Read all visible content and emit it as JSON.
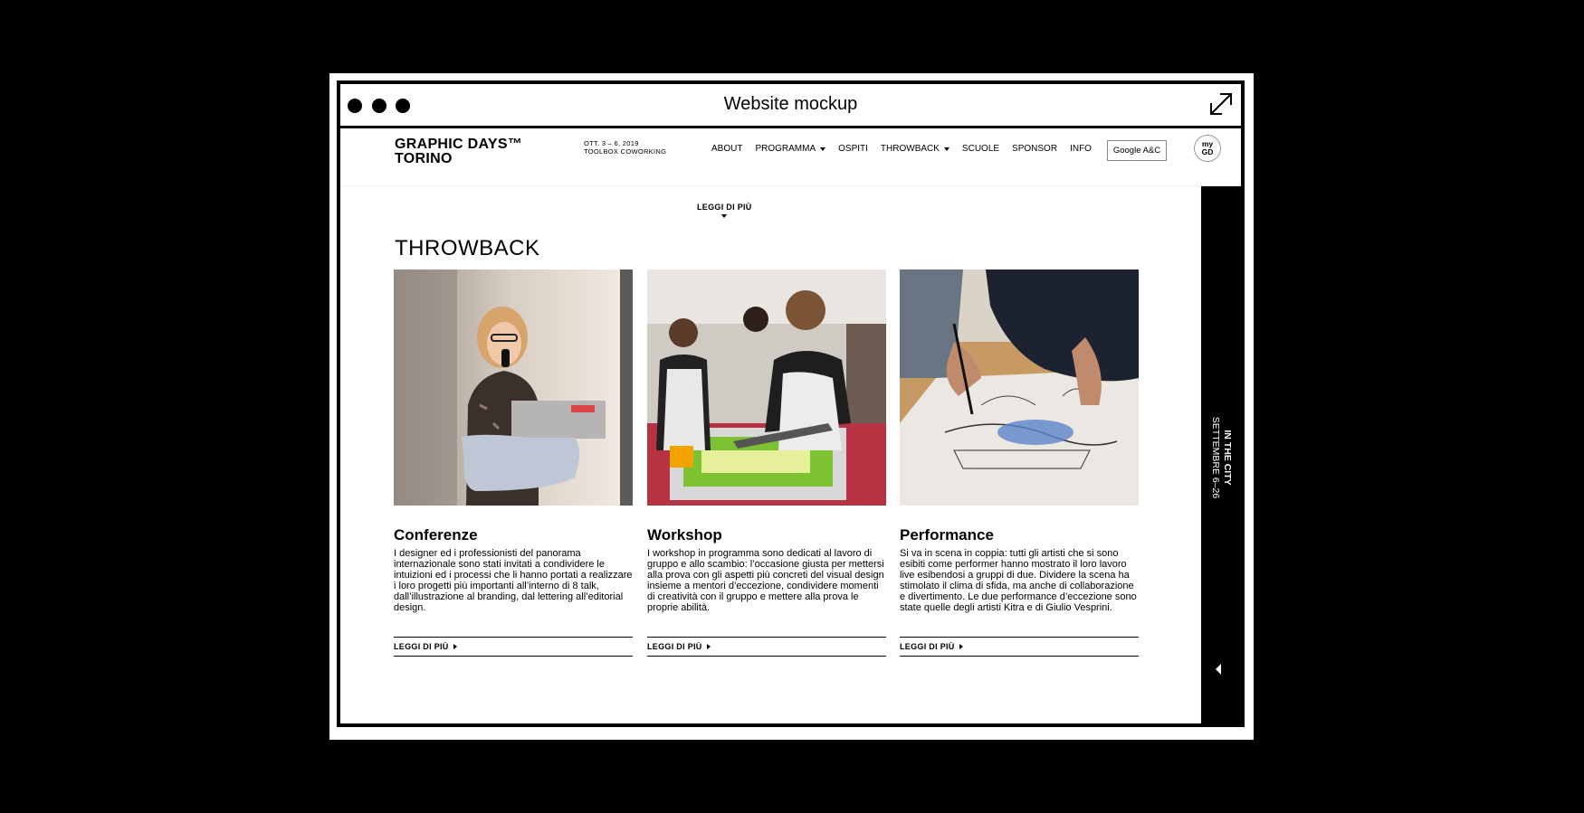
{
  "window": {
    "title": "Website mockup"
  },
  "site": {
    "logo": {
      "line1": "GRAPHIC DAYS™",
      "line2": "TORINO"
    },
    "event": {
      "line1": "OTT. 3 – 6, 2019",
      "line2": "TOOLBOX COWORKING"
    },
    "nav": [
      {
        "label": "ABOUT",
        "dropdown": false
      },
      {
        "label": "PROGRAMMA",
        "dropdown": true
      },
      {
        "label": "OSPITI",
        "dropdown": false
      },
      {
        "label": "THROWBACK",
        "dropdown": true
      },
      {
        "label": "SCUOLE",
        "dropdown": false
      },
      {
        "label": "SPONSOR",
        "dropdown": false
      },
      {
        "label": "INFO",
        "dropdown": false
      }
    ],
    "google_button": "Google A&C",
    "mygd": {
      "line1": "my",
      "line2": "GD"
    },
    "side_strip": {
      "line1": "IN THE CITY",
      "line2": "SETTEMBRE 6–26"
    },
    "readmore_top": "LEGGI DI PIÙ",
    "section_title": "THROWBACK",
    "cards": [
      {
        "title": "Conferenze",
        "text": "I designer ed i professionisti del panorama internazionale sono stati invitati a condividere le intuizioni ed i processi che li hanno portati a realizzare i loro progetti più importanti all’interno di 8 talk, dall’illustrazione al branding, dal lettering all’editorial design.",
        "link": "LEGGI DI PIÙ"
      },
      {
        "title": "Workshop",
        "text": "I workshop in programma sono dedicati al lavoro di gruppo e allo scambio: l’occasione giusta per mettersi alla prova con gli aspetti più concreti del visual design insieme a mentori d’eccezione, condividere momenti di creatività con il gruppo e mettere alla prova le proprie abilità.",
        "link": "LEGGI DI PIÙ"
      },
      {
        "title": "Performance",
        "text": "Si va in scena in coppia: tutti gli artisti che si sono esibiti come performer hanno mostrato il loro lavoro live esibendosi a gruppi di due. Dividere la scena ha stimolato il clima di sfida, ma anche di collaborazione e divertimento. Le due performance d’eccezione sono state quelle degli artisti Kitra e di Giulio Vesprini.",
        "link": "LEGGI DI PIÙ"
      }
    ]
  }
}
